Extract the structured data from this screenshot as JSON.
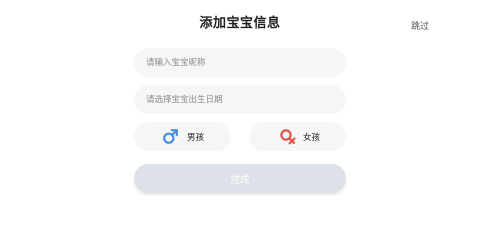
{
  "header": {
    "title": "添加宝宝信息",
    "skip_label": "跳过"
  },
  "form": {
    "nickname_placeholder": "请输入宝宝昵称",
    "nickname_value": "",
    "birthday_placeholder": "请选择宝宝出生日期",
    "birthday_value": "",
    "gender": {
      "boy_label": "男孩",
      "girl_label": "女孩",
      "boy_icon": "male-symbol-icon",
      "girl_icon": "female-symbol-icon",
      "selected": ""
    },
    "submit_label": "完成",
    "submit_enabled": false
  },
  "colors": {
    "background": "#ffffff",
    "field_background": "#f6f6f6",
    "placeholder": "#8c8c8c",
    "male_icon": "#4a8fe0",
    "female_icon": "#e8504a",
    "submit_disabled": "#dde2e9"
  }
}
